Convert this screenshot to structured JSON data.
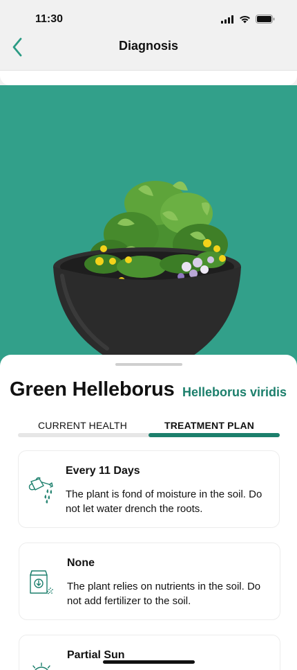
{
  "status_bar": {
    "time": "11:30"
  },
  "nav": {
    "title": "Diagnosis"
  },
  "plant": {
    "common_name": "Green Helleborus",
    "latin_name": "Helleborus viridis"
  },
  "tabs": {
    "current_health": "CURRENT HEALTH",
    "treatment_plan": "TREATMENT PLAN",
    "active": "TREATMENT PLAN"
  },
  "care": [
    {
      "icon": "watering-can-icon",
      "title": "Every 11 Days",
      "description": "The plant is fond of moisture in the soil. Do not let water drench the roots."
    },
    {
      "icon": "fertilizer-bag-icon",
      "title": "None",
      "description": "The plant relies on nutrients in the soil. Do not add fertilizer to the soil."
    },
    {
      "icon": "sun-icon",
      "title": "Partial Sun",
      "description": ""
    }
  ],
  "colors": {
    "accent": "#1c7f6c",
    "hero_background": "#32a08a",
    "pot": "#2b2b2b"
  }
}
